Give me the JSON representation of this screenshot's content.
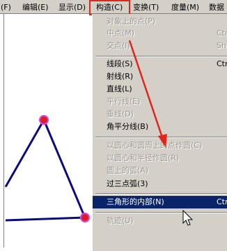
{
  "menubar": {
    "items": [
      "(F)",
      "编辑(E)",
      "显示(D)",
      "构造(C)",
      "变换(T)",
      "度量(M)",
      "数据"
    ]
  },
  "dropdown": {
    "items": [
      {
        "label": "对象上的点(P)",
        "shortcut": "",
        "disabled": true
      },
      {
        "label": "中点(M)",
        "shortcut": "Ctr",
        "disabled": true
      },
      {
        "label": "交点(I)",
        "shortcut": "Shi",
        "disabled": true
      },
      {
        "label": "线段(S)",
        "shortcut": "Ctr",
        "disabled": false
      },
      {
        "label": "射线(R)",
        "shortcut": "",
        "disabled": false
      },
      {
        "label": "直线(L)",
        "shortcut": "",
        "disabled": false
      },
      {
        "label": "平行线(E)",
        "shortcut": "",
        "disabled": true
      },
      {
        "label": "垂线(D)",
        "shortcut": "",
        "disabled": true
      },
      {
        "label": "角平分线(B)",
        "shortcut": "",
        "disabled": false
      },
      {
        "label": "以圆心和圆周上的点作圆(C)",
        "shortcut": "",
        "disabled": true
      },
      {
        "label": "以圆心和半径作圆(R)",
        "shortcut": "",
        "disabled": true
      },
      {
        "label": "圆上的弧(A)",
        "shortcut": "",
        "disabled": true
      },
      {
        "label": "过三点弧(3)",
        "shortcut": "",
        "disabled": false
      },
      {
        "label": "三角形的内部(N)",
        "shortcut": "Ctr",
        "disabled": false
      },
      {
        "label": "轨迹(U)",
        "shortcut": "",
        "disabled": true
      }
    ],
    "selected_label": "三角形的内部(N)"
  },
  "colors": {
    "annotation_red": "#e0261b",
    "triangle_stroke": "#0b0b80",
    "point_fill": "#d81e1e",
    "point_ring": "#e040e0",
    "menu_bg": "#d4d0c8",
    "highlight_bg": "#0a246a"
  },
  "icons": [
    "mouse-cursor-icon",
    "annotation-arrow-icon"
  ]
}
